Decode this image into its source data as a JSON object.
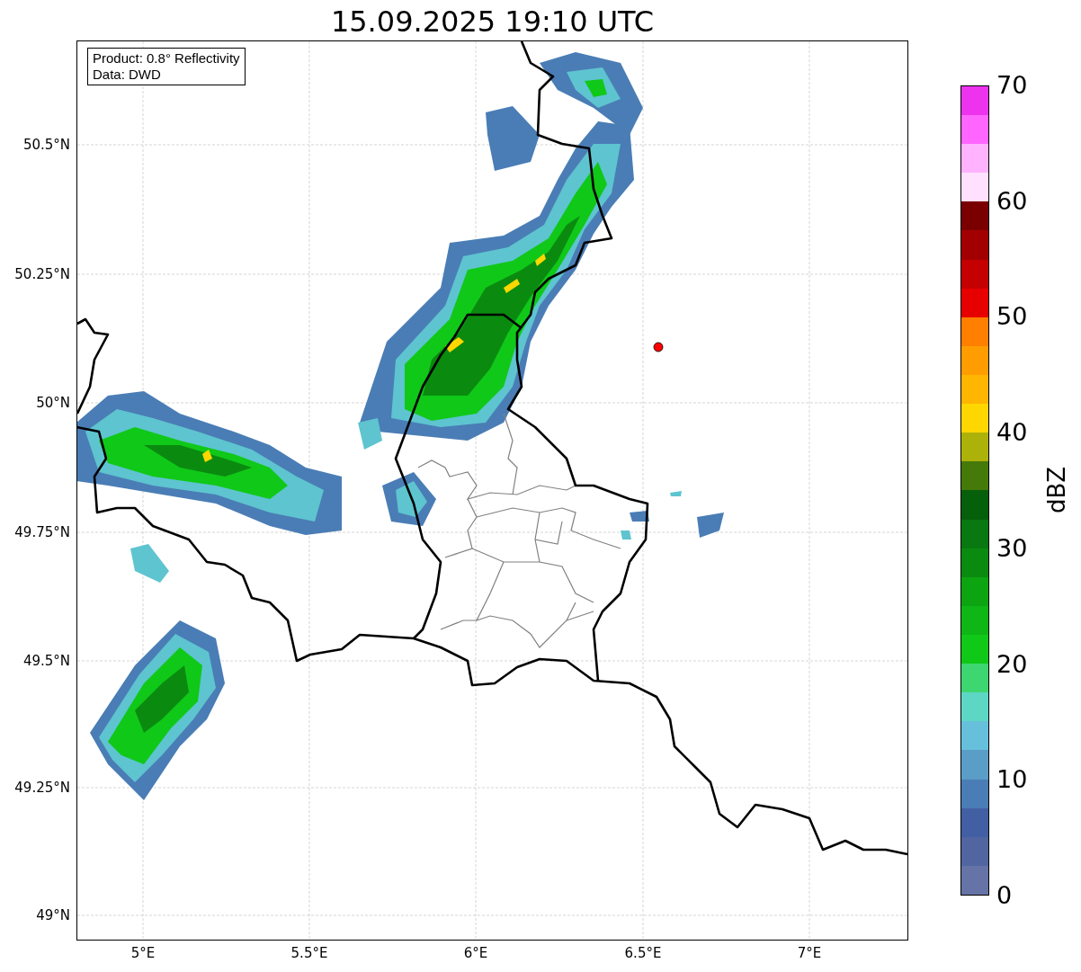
{
  "title": "15.09.2025 19:10 UTC",
  "annotation": [
    "Product: 0.8° Reflectivity",
    "Data: DWD"
  ],
  "y_ticks": [
    "50.5°N",
    "50.25°N",
    "50°N",
    "49.75°N",
    "49.5°N",
    "49.25°N",
    "49°N"
  ],
  "x_ticks": [
    "5°E",
    "5.5°E",
    "6°E",
    "6.5°E",
    "7°E"
  ],
  "colorbar": {
    "label": "dBZ",
    "ticks": [
      "70",
      "60",
      "50",
      "40",
      "30",
      "20",
      "10",
      "0"
    ],
    "segments": [
      {
        "color": "#6673a6"
      },
      {
        "color": "#5166a0"
      },
      {
        "color": "#435fa3"
      },
      {
        "color": "#4a7db5"
      },
      {
        "color": "#5a9dc6"
      },
      {
        "color": "#66c0dc"
      },
      {
        "color": "#5ed6c4"
      },
      {
        "color": "#3ed670"
      },
      {
        "color": "#10c818"
      },
      {
        "color": "#0eb616"
      },
      {
        "color": "#0da412"
      },
      {
        "color": "#0a8b10"
      },
      {
        "color": "#097810"
      },
      {
        "color": "#06600b"
      },
      {
        "color": "#457a0b"
      },
      {
        "color": "#adb20a"
      },
      {
        "color": "#ffd700"
      },
      {
        "color": "#ffb600"
      },
      {
        "color": "#ff9d00"
      },
      {
        "color": "#ff7f00"
      },
      {
        "color": "#e60000"
      },
      {
        "color": "#c40000"
      },
      {
        "color": "#a20000"
      },
      {
        "color": "#7a0000"
      },
      {
        "color": "#ffe0ff"
      },
      {
        "color": "#ffb3ff"
      },
      {
        "color": "#ff66ff"
      },
      {
        "color": "#ee33ee"
      }
    ]
  }
}
